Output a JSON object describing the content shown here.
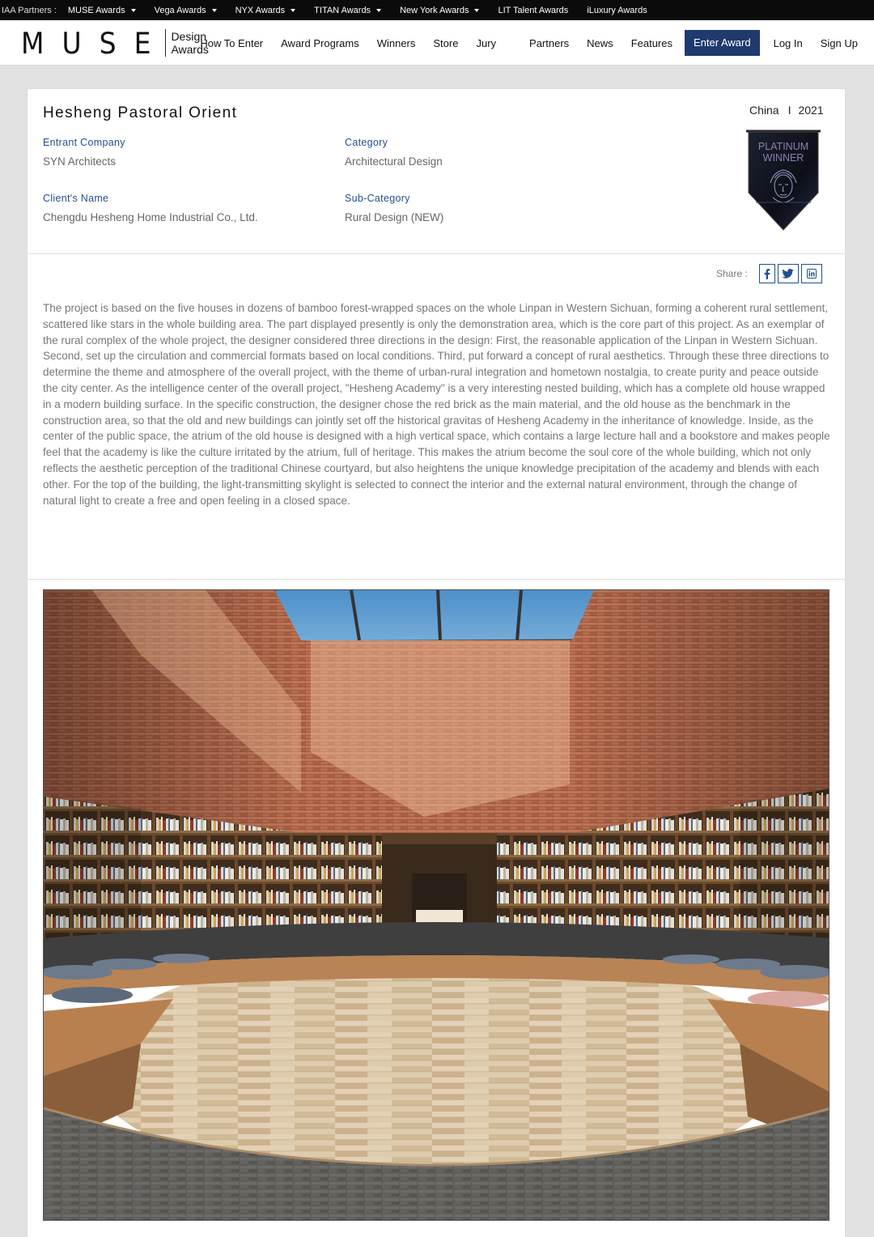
{
  "partner_bar": {
    "label": "IAA Partners :",
    "items": [
      {
        "label": "MUSE Awards",
        "dropdown": true
      },
      {
        "label": "Vega Awards",
        "dropdown": true
      },
      {
        "label": "NYX Awards",
        "dropdown": true
      },
      {
        "label": "TITAN Awards",
        "dropdown": true
      },
      {
        "label": "New York Awards",
        "dropdown": true
      },
      {
        "label": "LIT Talent Awards",
        "dropdown": false
      },
      {
        "label": "iLuxury Awards",
        "dropdown": false
      }
    ]
  },
  "header": {
    "logo_word": "MUSE",
    "logo_sub_1": "Design",
    "logo_sub_2": "Awards",
    "nav": [
      "How To Enter",
      "Award Programs",
      "Winners",
      "Store",
      "Jury",
      "Partners",
      "News",
      "Features"
    ],
    "cta": "Enter Award",
    "login": "Log In",
    "signup": "Sign Up",
    "accent_color": "#1e3a6e"
  },
  "entry": {
    "title": "Hesheng Pastoral Orient",
    "country": "China",
    "separator": "I",
    "year": "2021",
    "entrant_company_label": "Entrant Company",
    "entrant_company": "SYN Architects",
    "category_label": "Category",
    "category": "Architectural Design",
    "client_label": "Client's Name",
    "client": "Chengdu Hesheng Home Industrial Co., Ltd.",
    "subcategory_label": "Sub-Category",
    "subcategory": "Rural Design (NEW)",
    "badge_line1": "PLATINUM",
    "badge_line2": "WINNER",
    "share_label": "Share :",
    "share_icons": [
      "facebook-icon",
      "twitter-icon",
      "linkedin-icon"
    ],
    "description": "The project is based on the five houses in dozens of bamboo forest-wrapped spaces on the whole Linpan in Western Sichuan, forming a coherent rural settlement, scattered like stars in the whole building area. The part displayed presently is only the demonstration area, which is the core part of this project. As an exemplar of the rural complex of the whole project, the designer considered three directions in the design: First, the reasonable application of the Linpan in Western Sichuan. Second, set up the circulation and commercial formats based on local conditions. Third, put forward a concept of rural aesthetics. Through these three directions to determine the theme and atmosphere of the overall project, with the theme of urban-rural integration and hometown nostalgia, to create purity and peace outside the city center. As the intelligence center of the overall project, \"Hesheng Academy\" is a very interesting nested building, which has a complete old house wrapped in a modern building surface. In the specific construction, the designer chose the red brick as the main material, and the old house as the benchmark in the construction area, so that the old and new buildings can jointly set off the historical gravitas of Hesheng Academy in the inheritance of knowledge. Inside, as the center of the public space, the atrium of the old house is designed with a high vertical space, which contains a large lecture hall and a bookstore and makes people feel that the academy is like the culture irritated by the atrium, full of heritage. This makes the atrium become the soul core of the whole building, which not only reflects the aesthetic perception of the traditional Chinese courtyard, but also heightens the unique knowledge precipitation of the academy and blends with each other. For the top of the building, the light-transmitting skylight is selected to connect the interior and the external natural environment, through the change of natural light to create a free and open feeling in a closed space."
  }
}
